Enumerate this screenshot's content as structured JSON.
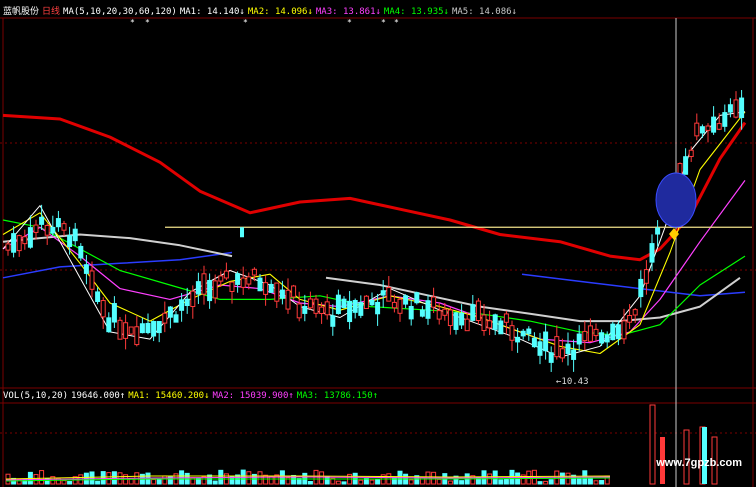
{
  "header": {
    "stock_name": "蓝帆股份",
    "period": "日线",
    "ma_spec": "MA(5,10,20,30,60,120)",
    "ma1": "MA1: 14.140↓",
    "ma2": "MA2: 14.096↓",
    "ma3": "MA3: 13.861↓",
    "ma4": "MA4: 13.935↓",
    "ma5": "MA5: 14.086↓"
  },
  "volume_header": {
    "spec": "VOL(5,10,20)",
    "vol": "19646.000↑",
    "ma1": "MA1: 15460.200↓",
    "ma2": "MA2: 15039.900↑",
    "ma3": "MA3: 13786.150↑"
  },
  "low_label": "←10.43",
  "watermark": "www.7gpzb.com",
  "colors": {
    "up": "#ff3a3a",
    "down": "#54ffff",
    "ma1": "#ffffff",
    "ma2": "#ffff00",
    "ma3": "#ff40ff",
    "ma4": "#00ff00",
    "ma5": "#b0b0b0",
    "ma6": "#2a3cff",
    "ma120": "#e00000",
    "hline": "#f0e08a",
    "grid": "#7a0000"
  },
  "chart_data": {
    "type": "candlestick",
    "ylim": [
      9.8,
      20.0
    ],
    "low_price": 10.43,
    "horizontal_line": 14.2,
    "series": [
      {
        "name": "MA1",
        "color": "ma1"
      },
      {
        "name": "MA2",
        "color": "ma2"
      },
      {
        "name": "MA3",
        "color": "ma3"
      },
      {
        "name": "MA4",
        "color": "ma4"
      },
      {
        "name": "MA5",
        "color": "ma5"
      }
    ]
  }
}
